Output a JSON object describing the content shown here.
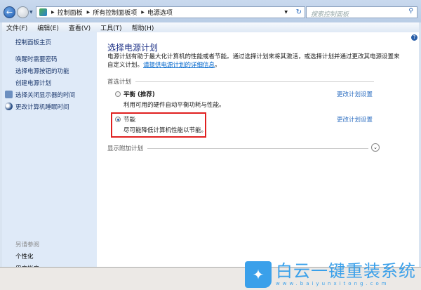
{
  "address": {
    "crumbs": [
      "控制面板",
      "所有控制面板项",
      "电源选项"
    ]
  },
  "search": {
    "placeholder": "搜索控制面板"
  },
  "menu": [
    "文件(F)",
    "编辑(E)",
    "查看(V)",
    "工具(T)",
    "帮助(H)"
  ],
  "sidebar": {
    "home": "控制面板主页",
    "items": [
      "唤醒时需要密码",
      "选择电源按钮的功能",
      "创建电源计划",
      "选择关闭显示器的时间",
      "更改计算机睡眠时间"
    ],
    "see_also": "另请参阅",
    "links": [
      "个性化",
      "用户帐户"
    ]
  },
  "main": {
    "title": "选择电源计划",
    "desc": "电源计划有助于最大化计算机的性能或者节能。通过选择计划来将其激活，或选择计划并通过更改其电源设置来自定义计划。",
    "desc_link": "请提供电源计划的详细信息",
    "desc_end": "。",
    "preferred": "首选计划",
    "plans": [
      {
        "name": "平衡 (推荐)",
        "desc": "利用可用的硬件自动平衡功耗与性能。",
        "change": "更改计划设置",
        "selected": false
      },
      {
        "name": "节能",
        "desc": "尽可能降低计算机性能以节能。",
        "change": "更改计划设置",
        "selected": true
      }
    ],
    "show_more": "显示附加计划"
  },
  "watermark": {
    "title": "白云一键重装系统",
    "url": "www.baiyunxitong.com"
  }
}
